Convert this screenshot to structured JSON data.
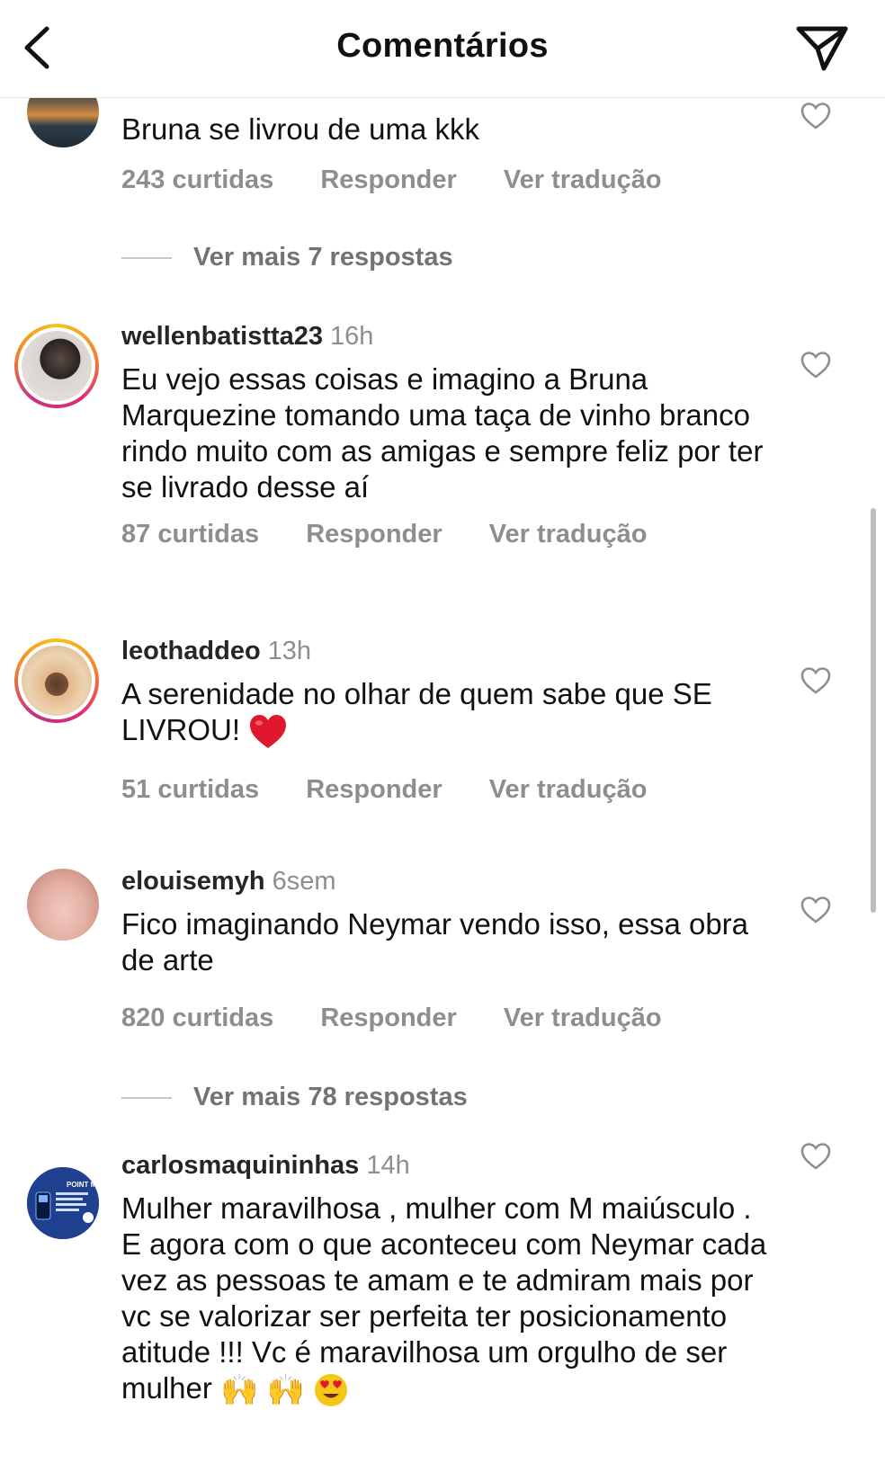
{
  "header": {
    "title": "Comentários"
  },
  "colors": {
    "muted": "#8e8e8e",
    "heart_red": "#e0182d",
    "ring_gradient": [
      "#f5c518",
      "#f58529",
      "#dd2a7b"
    ]
  },
  "comments": [
    {
      "username": "",
      "time": "",
      "text": "Bruna se livrou de uma kkk",
      "likes": "243 curtidas",
      "reply": "Responder",
      "translate": "Ver tradução",
      "avatar_icon": "sunset-photo",
      "avatar_ring": false
    },
    {
      "username": "wellenbatistta23",
      "time": "16h",
      "text": "Eu vejo essas coisas e imagino a Bruna Marquezine tomando uma taça de vinho branco rindo muito com as amigas e sempre feliz por ter se livrado desse aí",
      "likes": "87 curtidas",
      "reply": "Responder",
      "translate": "Ver tradução",
      "avatar_icon": "woman-photo",
      "avatar_ring": true
    },
    {
      "username": "leothaddeo",
      "time": "13h",
      "text": "A serenidade no olhar de quem sabe que SE LIVROU!",
      "text_emoji": "red-heart-emoji",
      "likes": "51 curtidas",
      "reply": "Responder",
      "translate": "Ver tradução",
      "avatar_icon": "beach-man-photo",
      "avatar_ring": true
    },
    {
      "username": "elouisemyh",
      "time": "6sem",
      "text": "Fico imaginando Neymar vendo isso, essa obra de arte",
      "likes": "820 curtidas",
      "reply": "Responder",
      "translate": "Ver tradução",
      "avatar_icon": "face-closeup-photo",
      "avatar_ring": false
    },
    {
      "username": "carlosmaquininhas",
      "time": "14h",
      "text": "Mulher maravilhosa , mulher com M maiúsculo . E agora com o que aconteceu com Neymar cada vez as pessoas te amam e te admiram mais por vc se valorizar ser perfeita ter posicionamento atitude !!! Vc é maravilhosa um orgulho de ser mulher",
      "text_emoji": [
        "raising-hands-emoji",
        "raising-hands-emoji",
        "heart-eyes-emoji"
      ],
      "avatar_label": "POINT MINI",
      "avatar_icon": "card-machine-logo",
      "avatar_ring": false
    }
  ],
  "view_more": [
    {
      "label": "Ver mais 7 respostas"
    },
    {
      "label": "Ver mais 78 respostas"
    }
  ]
}
